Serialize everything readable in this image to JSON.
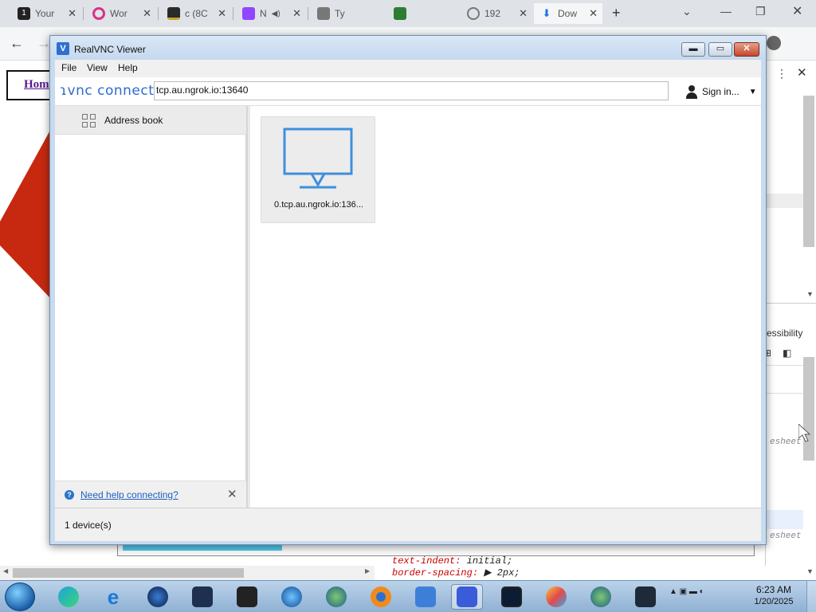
{
  "browser": {
    "tabs": [
      {
        "label": "Your",
        "fav": "1",
        "color": "#222222"
      },
      {
        "label": "Wor",
        "fav": "",
        "color": "#d63384"
      },
      {
        "label": "c (8C",
        "fav": "",
        "color": "#8a6d1d"
      },
      {
        "label": "N",
        "fav": "",
        "color": "#9146ff"
      },
      {
        "label": "Ty",
        "fav": "",
        "color": "#666666"
      },
      {
        "label": "",
        "fav": "",
        "color": "#2e7d32"
      },
      {
        "label": "192",
        "fav": "",
        "color": "#777777"
      },
      {
        "label": "Dow",
        "fav": "",
        "color": "#1a73e8"
      }
    ],
    "new_tab": "+",
    "page": {
      "home_link": "Hom"
    },
    "devtools": {
      "panel_label": "essibility",
      "stylesheet_1": "esheet",
      "stylesheet_2": "esheet"
    },
    "css_lines": [
      {
        "prop": "text-indent:",
        "val": "initial;"
      },
      {
        "prop": "border-spacing:",
        "val": "▶ 2px;"
      }
    ]
  },
  "vnc": {
    "title": "RealVNC Viewer",
    "menu": [
      "File",
      "View",
      "Help"
    ],
    "brand": "ɿvnc connect",
    "address_value": "tcp.au.ngrok.io:13640",
    "sign_in": "Sign in...",
    "sidebar": {
      "address_book": "Address book",
      "help_link": "Need help connecting?"
    },
    "devices": [
      {
        "label": "0.tcp.au.ngrok.io:136..."
      }
    ],
    "status": "1 device(s)",
    "accent_color": "#2e6bcf"
  },
  "taskbar": {
    "time": "6:23 AM",
    "date": "1/20/2025",
    "icons": [
      "edge-icon",
      "ie-icon",
      "earth-icon",
      "moon-icon",
      "box-icon",
      "media-player-icon",
      "globe-icon",
      "blender-icon",
      "realvnc-icon",
      "kde-icon",
      "monitor-icon",
      "paint-icon",
      "globe2-icon",
      "terminal-icon"
    ]
  }
}
